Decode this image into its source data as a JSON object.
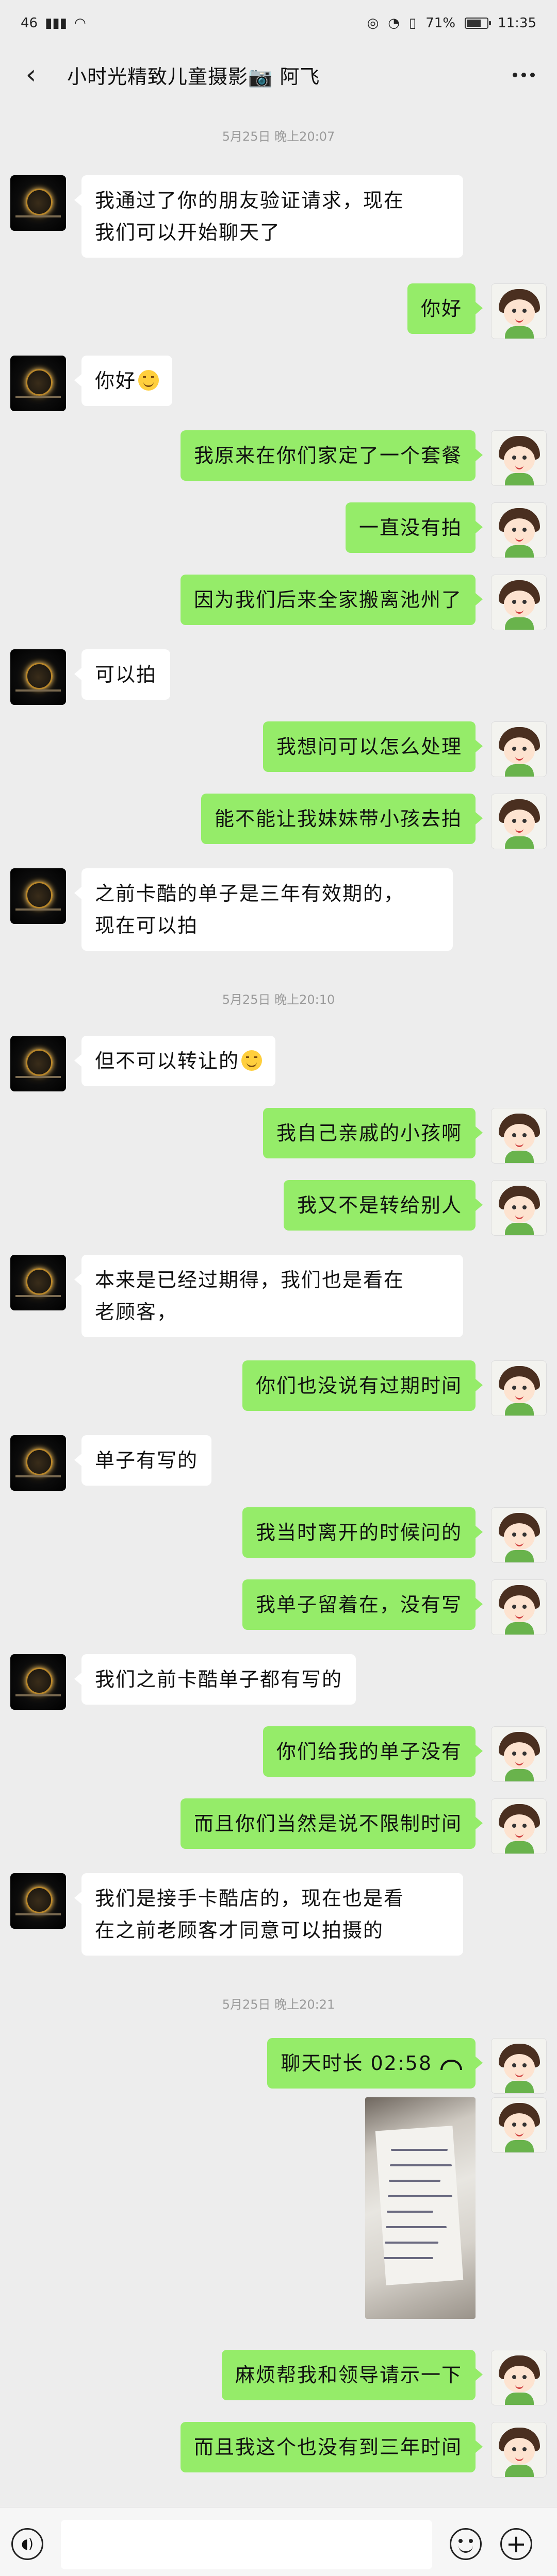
{
  "status_bar": {
    "signal": "46",
    "battery": "71%",
    "battery_level": 0.71,
    "time": "11:35"
  },
  "header": {
    "title": "小时光精致儿童摄影📷 阿飞"
  },
  "timestamps": [
    "5月25日 晚上20:07",
    "5月25日 晚上20:10",
    "5月25日 晚上20:21"
  ],
  "messages": [
    {
      "side": "left",
      "lines": [
        "我通过了你的朋友验证请求，现在",
        "我们可以开始聊天了"
      ]
    },
    {
      "side": "right",
      "text": "你好"
    },
    {
      "side": "left",
      "text": "你好",
      "emoji": "smile-emoji"
    },
    {
      "side": "right",
      "text": "我原来在你们家定了一个套餐"
    },
    {
      "side": "right",
      "text": "一直没有拍"
    },
    {
      "side": "right",
      "text": "因为我们后来全家搬离池州了"
    },
    {
      "side": "left",
      "text": "可以拍"
    },
    {
      "side": "right",
      "text": "我想问可以怎么处理"
    },
    {
      "side": "right",
      "text": "能不能让我妹妹带小孩去拍"
    },
    {
      "side": "left",
      "lines": [
        "之前卡酷的单子是三年有效期的，",
        "现在可以拍"
      ]
    },
    {
      "side": "left",
      "text": "但不可以转让的",
      "emoji": "smile-emoji"
    },
    {
      "side": "right",
      "text": "我自己亲戚的小孩啊"
    },
    {
      "side": "right",
      "text": "我又不是转给别人"
    },
    {
      "side": "left",
      "lines": [
        "本来是已经过期得，我们也是看在",
        "老顾客，"
      ]
    },
    {
      "side": "right",
      "text": "你们也没说有过期时间"
    },
    {
      "side": "left",
      "text": "单子有写的"
    },
    {
      "side": "right",
      "text": "我当时离开的时候问的"
    },
    {
      "side": "right",
      "text": "我单子留着在，没有写"
    },
    {
      "side": "left",
      "text": "我们之前卡酷单子都有写的"
    },
    {
      "side": "right",
      "text": "你们给我的单子没有"
    },
    {
      "side": "right",
      "text": "而且你们当然是说不限制时间"
    },
    {
      "side": "left",
      "lines": [
        "我们是接手卡酷店的，现在也是看",
        "在之前老顾客才同意可以拍摄的"
      ]
    },
    {
      "side": "right",
      "text": "聊天时长 02:58",
      "icon": "call-icon"
    },
    {
      "side": "right",
      "type": "image",
      "icon": "photo-of-receipt"
    },
    {
      "side": "right",
      "text": "麻烦帮我和领导请示一下"
    },
    {
      "side": "right",
      "text": "而且我这个也没有到三年时间"
    }
  ],
  "input_bar": {
    "placeholder": ""
  }
}
